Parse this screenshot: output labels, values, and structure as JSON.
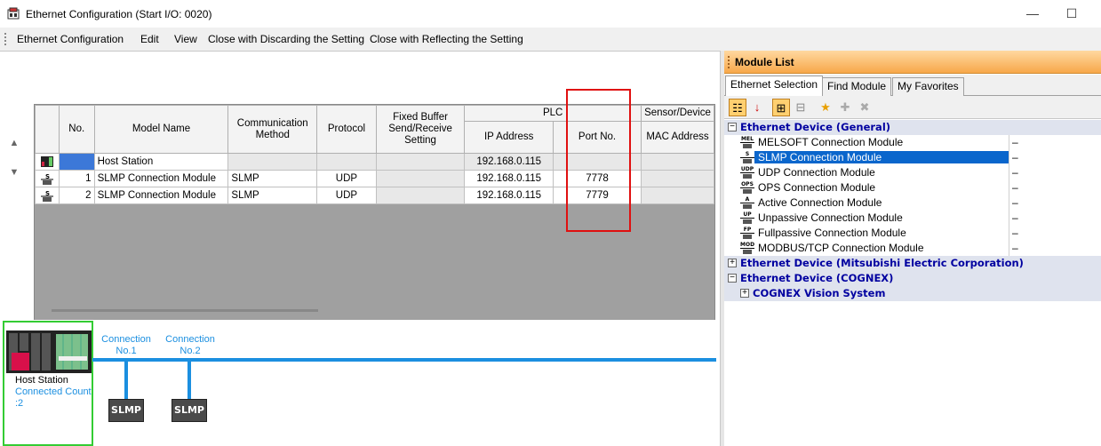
{
  "window": {
    "title": "Ethernet Configuration (Start I/O: 0020)",
    "minimize": "—",
    "maximize": "☐"
  },
  "menu": [
    "Ethernet Configuration",
    "Edit",
    "View",
    "Close with Discarding the Setting",
    "Close with Reflecting the Setting"
  ],
  "grid": {
    "headers": {
      "no": "No.",
      "model": "Model Name",
      "comm": "Communication Method",
      "protocol": "Protocol",
      "fixed": "Fixed Buffer Send/Receive Setting",
      "plc_group": "PLC",
      "ip": "IP Address",
      "port": "Port No.",
      "sensor_group": "Sensor/Device",
      "mac": "MAC Address"
    },
    "rows": [
      {
        "no": "",
        "model": "Host Station",
        "comm": "",
        "protocol": "",
        "fixed": "",
        "ip": "192.168.0.115",
        "port": "",
        "mac": ""
      },
      {
        "no": "1",
        "model": "SLMP Connection Module",
        "comm": "SLMP",
        "protocol": "UDP",
        "fixed": "",
        "ip": "192.168.0.115",
        "port": "7778",
        "mac": ""
      },
      {
        "no": "2",
        "model": "SLMP Connection Module",
        "comm": "SLMP",
        "protocol": "UDP",
        "fixed": "",
        "ip": "192.168.0.115",
        "port": "7779",
        "mac": ""
      }
    ]
  },
  "diagram": {
    "connections": [
      "Connection\nNo.1",
      "Connection\nNo.2"
    ],
    "conn1_a": "Connection",
    "conn1_b": "No.1",
    "conn2_a": "Connection",
    "conn2_b": "No.2",
    "host_label": "Host Station",
    "host_count_a": "Connected Count",
    "host_count_b": ":2",
    "slmp_label": "SLMP",
    "bus_color": "#1b8fe0",
    "host_border_color": "#33cc33"
  },
  "module_list": {
    "title": "Module List",
    "tabs": [
      "Ethernet Selection",
      "Find Module",
      "My Favorites"
    ],
    "categories": {
      "general": "Ethernet Device (General)",
      "mitsubishi": "Ethernet Device (Mitsubishi Electric Corporation)",
      "cognex": "Ethernet Device (COGNEX)",
      "cognex_vision": "COGNEX Vision System"
    },
    "modules": [
      {
        "icon_text": "MEL",
        "label": "MELSOFT Connection Module",
        "value": "–"
      },
      {
        "icon_text": "S",
        "label": "SLMP Connection Module",
        "value": "–"
      },
      {
        "icon_text": "UDP",
        "label": "UDP Connection Module",
        "value": "–"
      },
      {
        "icon_text": "OPS",
        "label": "OPS Connection Module",
        "value": "–"
      },
      {
        "icon_text": "A",
        "label": "Active Connection Module",
        "value": "–"
      },
      {
        "icon_text": "UP",
        "label": "Unpassive Connection Module",
        "value": "–"
      },
      {
        "icon_text": "FP",
        "label": "Fullpassive Connection Module",
        "value": "–"
      },
      {
        "icon_text": "MOD",
        "label": "MODBUS/TCP Connection Module",
        "value": "–"
      }
    ],
    "selected_color": "#0a66cc"
  },
  "highlight_color": "#e01010"
}
